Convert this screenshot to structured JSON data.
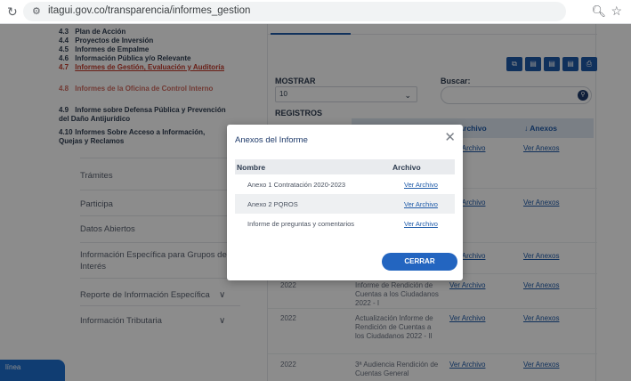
{
  "browser": {
    "url": "itagui.gov.co/transparencia/informes_gestion"
  },
  "sidebar": {
    "sub_items": [
      {
        "num": "4.3",
        "text": "Plan de Acción"
      },
      {
        "num": "4.4",
        "text": "Proyectos de Inversión"
      },
      {
        "num": "4.5",
        "text": "Informes de Empalme"
      },
      {
        "num": "4.6",
        "text": "Información Pública y/o Relevante"
      },
      {
        "num": "4.7",
        "text": "Informes de Gestión, Evaluación y Auditoría"
      },
      {
        "num": "4.8",
        "text": "Informes de la Oficina de Control Interno"
      },
      {
        "num": "4.9",
        "text": "Informe sobre Defensa Pública y Prevención del Daño Antijurídico"
      },
      {
        "num": "4.10",
        "text": "Informes Sobre Acceso a Información, Quejas y Reclamos"
      }
    ],
    "main_items": [
      "Trámites",
      "Participa",
      "Datos Abiertos",
      "Información Específica para Grupos de Interés",
      "Reporte de Información Específica",
      "Información Tributaria"
    ]
  },
  "main": {
    "mostrar_label": "MOSTRAR",
    "mostrar_value": "10",
    "registros_label": "REGISTROS",
    "buscar_label": "Buscar:",
    "columns": {
      "archivo": "Archivo",
      "anexos": "↓ Anexos"
    },
    "rows": [
      {
        "year": "",
        "desc": "",
        "archivo": "Ver Archivo",
        "anexos": "Ver Anexos"
      },
      {
        "year": "",
        "desc": "",
        "archivo": "Ver Archivo",
        "anexos": "Ver Anexos"
      },
      {
        "year": "",
        "desc": "",
        "archivo": "Ver Archivo",
        "anexos": "Ver Anexos"
      },
      {
        "year": "2022",
        "desc": "Informe de Rendición de Cuentas a los Ciudadanos 2022 - I",
        "archivo": "Ver Archivo",
        "anexos": "Ver Anexos"
      },
      {
        "year": "2022",
        "desc": "Actualización Informe de Rendición de Cuentas a los Ciudadanos 2022 - II",
        "archivo": "Ver Archivo",
        "anexos": "Ver Anexos"
      },
      {
        "year": "2022",
        "desc": "3ª Audiencia Rendición de Cuentas General",
        "archivo": "Ver Archivo",
        "anexos": "Ver Anexos"
      }
    ]
  },
  "chat_tab": "línea",
  "modal": {
    "title": "Anexos del Informe",
    "col_nombre": "Nombre",
    "col_archivo": "Archivo",
    "rows": [
      {
        "nombre": "Anexo 1 Contratación 2020-2023",
        "link": "Ver Archivo"
      },
      {
        "nombre": "Anexo 2 PQROS",
        "link": "Ver Archivo"
      },
      {
        "nombre": "Informe de preguntas y comentarios",
        "link": "Ver Archivo"
      }
    ],
    "close_label": "CERRAR"
  },
  "colors": {
    "accent": "#1e5aa8",
    "button": "#2365c0",
    "active_link": "#c0392b"
  }
}
